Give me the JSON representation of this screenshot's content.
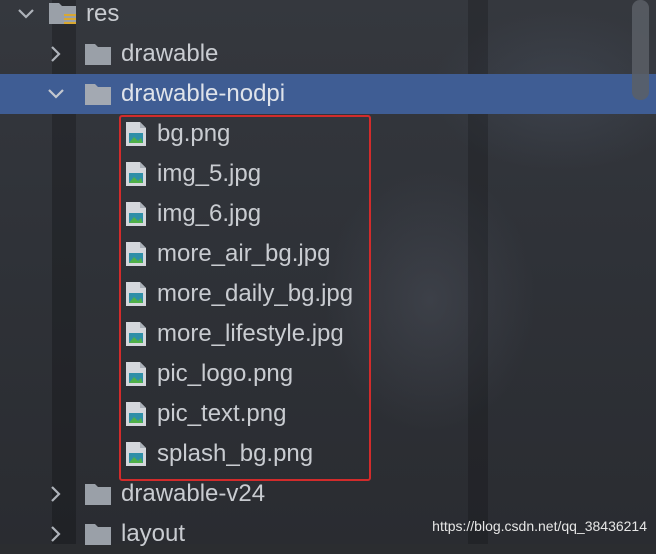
{
  "tree": {
    "root": {
      "label": "res",
      "expanded": true
    },
    "folders": [
      {
        "label": "drawable",
        "expanded": false
      },
      {
        "label": "drawable-nodpi",
        "expanded": true,
        "selected": true
      },
      {
        "label": "drawable-v24",
        "expanded": false
      },
      {
        "label": "layout",
        "expanded": false
      }
    ],
    "files": [
      {
        "label": "bg.png"
      },
      {
        "label": "img_5.jpg"
      },
      {
        "label": "img_6.jpg"
      },
      {
        "label": "more_air_bg.jpg"
      },
      {
        "label": "more_daily_bg.jpg"
      },
      {
        "label": "more_lifestyle.jpg"
      },
      {
        "label": "pic_logo.png"
      },
      {
        "label": "pic_text.png"
      },
      {
        "label": "splash_bg.png"
      }
    ]
  },
  "icons": {
    "folder": "folder-icon",
    "resource_folder": "resource-folder-icon",
    "image_file": "image-file-icon",
    "expand": "chevron-right-icon",
    "collapse": "chevron-down-icon"
  },
  "colors": {
    "selection": "#3f5d94",
    "highlight_box": "#d22b2b",
    "folder": "#9aa0a8",
    "text": "#c9ccd1"
  },
  "watermark": "https://blog.csdn.net/qq_38436214"
}
